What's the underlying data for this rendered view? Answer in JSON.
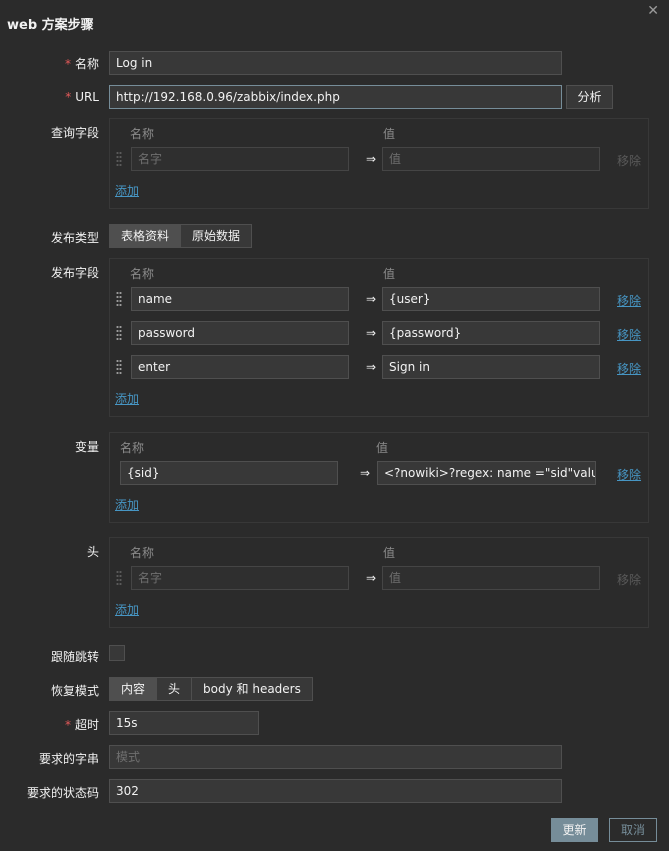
{
  "dialog": {
    "title": "web 方案步骤",
    "close_icon": "close-icon"
  },
  "labels": {
    "name": "名称",
    "url": "URL",
    "query": "查询字段",
    "post_type": "发布类型",
    "post_fields": "发布字段",
    "variables": "变量",
    "headers": "头",
    "follow_redirects": "跟随跳转",
    "retrieve_mode": "恢复模式",
    "timeout": "超时",
    "required_string": "要求的字串",
    "status_codes": "要求的状态码"
  },
  "name_value": "Log  in",
  "url_value": "http://192.168.0.96/zabbix/index.php",
  "parse_button": "分析",
  "table_headers": {
    "name": "名称",
    "value": "值"
  },
  "arrow": "⇒",
  "add_link": "添加",
  "remove_link": "移除",
  "query": {
    "name_placeholder": "名字",
    "value_placeholder": "值"
  },
  "post_type_options": [
    "表格资料",
    "原始数据"
  ],
  "post_type_selected": "表格资料",
  "post_fields": [
    {
      "name": "name",
      "value": "{user}"
    },
    {
      "name": "password",
      "value": "{password}"
    },
    {
      "name": "enter",
      "value": "Sign in"
    }
  ],
  "variables": [
    {
      "name": "{sid}",
      "value": "<?nowiki>?regex: name =\"sid\"value = '"
    }
  ],
  "headers": {
    "name_placeholder": "名字",
    "value_placeholder": "值"
  },
  "follow_redirects_checked": false,
  "retrieve_mode_options": [
    "内容",
    "头",
    "body 和 headers"
  ],
  "retrieve_mode_selected": "内容",
  "timeout_value": "15s",
  "required_string_placeholder": "模式",
  "status_codes_value": "302",
  "footer": {
    "update": "更新",
    "cancel": "取消"
  },
  "colors": {
    "background": "#2b2b2b",
    "link": "#4796c4",
    "required": "#e45959",
    "primary": "#768d99"
  }
}
